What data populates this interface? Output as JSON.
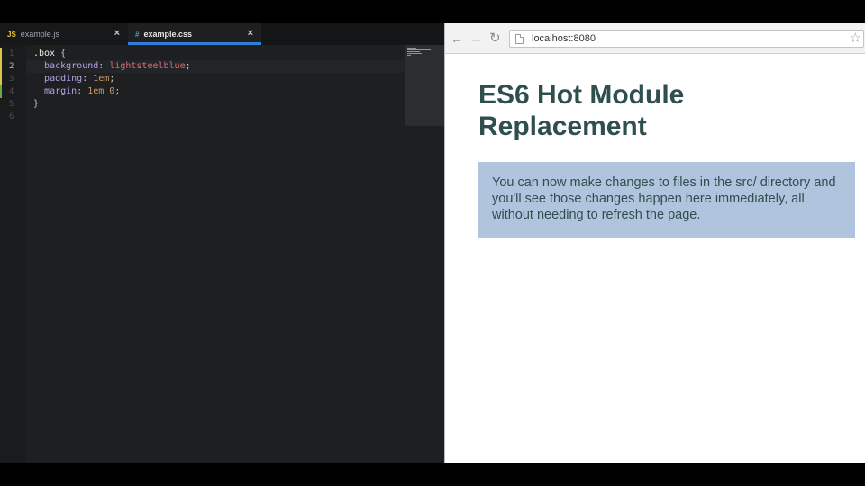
{
  "editor": {
    "tabs": [
      {
        "icon": "JS",
        "label": "example.js",
        "active": false
      },
      {
        "icon": "#",
        "label": "example.css",
        "active": true
      }
    ],
    "close_glyph": "×",
    "line_numbers": [
      "1",
      "2",
      "3",
      "4",
      "5",
      "6"
    ],
    "code": {
      "line1": {
        "selector": ".box",
        "brace": " {"
      },
      "line2": {
        "indent": "  ",
        "prop": "background",
        "colon": ": ",
        "value": "lightsteelblue",
        "semi": ";"
      },
      "line3": {
        "indent": "  ",
        "prop": "padding",
        "colon": ": ",
        "value": "1em",
        "semi": ";"
      },
      "line4": {
        "indent": "  ",
        "prop": "margin",
        "colon": ": ",
        "value": "1em 0",
        "semi": ";"
      },
      "line5": {
        "brace": "}"
      }
    }
  },
  "browser": {
    "back_glyph": "←",
    "forward_glyph": "→",
    "reload_glyph": "↻",
    "url": "localhost:8080",
    "star_glyph": "☆",
    "page": {
      "title": "ES6 Hot Module Replacement",
      "box_text": "You can now make changes to files in the src/ directory and you'll see those changes happen here immediately, all without needing to refresh the page."
    }
  },
  "colors": {
    "box_background": "#b0c4de",
    "heading_text": "#2f4f4f",
    "active_tab_underline": "#2f7fd6"
  }
}
